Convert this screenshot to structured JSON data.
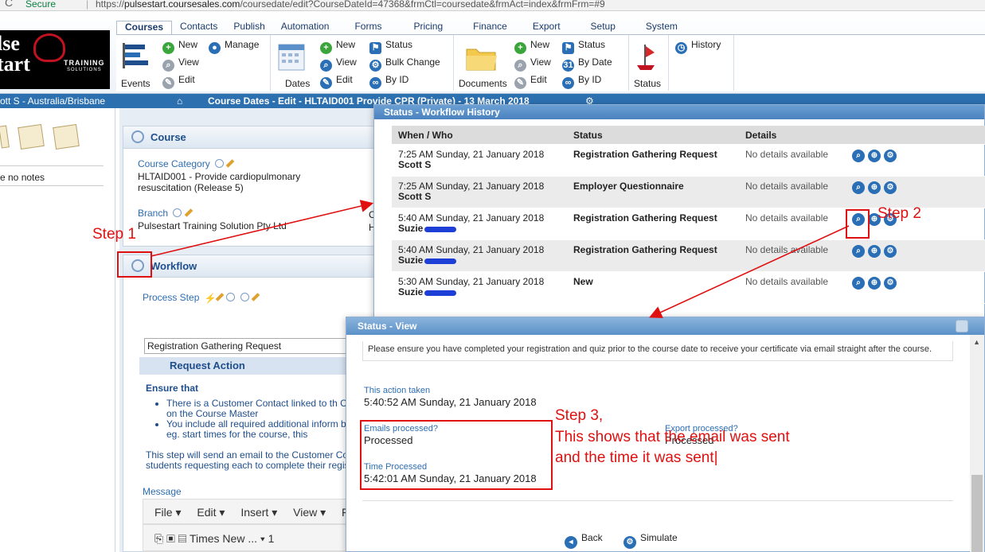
{
  "browser": {
    "secure_label": "Secure",
    "url_prefix": "https://",
    "url_host": "pulsestart.coursesales.com",
    "url_path": "/coursedate/edit?CourseDateId=47368&frmCtl=coursedate&frmAct=index&frmFrm=#9"
  },
  "logo": {
    "line1": "lse",
    "line2": "tart",
    "line3": "TRAINING",
    "line4": "SOLUTIONS"
  },
  "menu": {
    "tabs": [
      "Courses",
      "Contacts",
      "Publish",
      "Automation",
      "Forms",
      "Pricing",
      "Finance",
      "Export",
      "Setup",
      "System"
    ],
    "active": "Courses"
  },
  "ribbon": {
    "events_label": "Events",
    "events_new": "New",
    "events_manage": "Manage",
    "events_view": "View",
    "events_edit": "Edit",
    "dates_label": "Dates",
    "dates_new": "New",
    "dates_status": "Status",
    "dates_view": "View",
    "dates_bulk": "Bulk Change",
    "dates_edit": "Edit",
    "dates_byid": "By ID",
    "documents_label": "Documents",
    "docs_new": "New",
    "docs_status": "Status",
    "docs_view": "View",
    "docs_bydate": "By Date",
    "docs_edit": "Edit",
    "docs_byid": "By ID",
    "status_label": "Status",
    "history_label": "History"
  },
  "statusbar": {
    "location": "ott S - Australia/Brisbane",
    "title": "Course Dates - Edit - HLTAID001 Provide CPR (Private) - 13 March 2018"
  },
  "sidebar": {
    "notes_text": "e no notes"
  },
  "course_panel": {
    "heading": "Course",
    "category_label": "Course Category",
    "category_value": "HLTAID001 - Provide cardiopulmonary resuscitation (Release 5)",
    "branch_label": "Branch",
    "branch_value": "Pulsestart Training Solution Pty Ltd",
    "col_label_c": "C",
    "col_value_h": "H"
  },
  "workflow_panel": {
    "heading": "Workflow",
    "process_step_label": "Process Step",
    "process_step_value": "Registration Gathering Request",
    "request_action": "Request Action",
    "ensure_that": "Ensure that",
    "bullet1": "There is a Customer Contact linked to th Contact on the Course Master",
    "bullet2": "You include all required additional inform below, eg. start times for the course, this",
    "step_text": "This step will send an email to the Customer Co students requesting each to complete their regis",
    "message_label": "Message",
    "editor_menu": [
      "File ▾",
      "Edit ▾",
      "Insert ▾",
      "View ▾",
      "F"
    ],
    "font_name": "Times New ...",
    "font_size": "1"
  },
  "history_dialog": {
    "title": "Status - Workflow History",
    "headers": [
      "When / Who",
      "Status",
      "Details"
    ],
    "rows": [
      {
        "when": "7:25 AM Sunday, 21 January 2018",
        "who": "Scott S",
        "status": "Registration Gathering Request",
        "details": "No details available"
      },
      {
        "when": "7:25 AM Sunday, 21 January 2018",
        "who": "Scott S",
        "status": "Employer Questionnaire",
        "details": "No details available"
      },
      {
        "when": "5:40 AM Sunday, 21 January 2018",
        "who": "Suzie",
        "status": "Registration Gathering Request",
        "details": "No details available"
      },
      {
        "when": "5:40 AM Sunday, 21 January 2018",
        "who": "Suzie",
        "status": "Registration Gathering Request",
        "details": "No details available"
      },
      {
        "when": "5:30 AM Sunday, 21 January 2018",
        "who": "Suzie",
        "status": "New",
        "details": "No details available"
      }
    ]
  },
  "status_view": {
    "title": "Status - View",
    "message": "Please ensure you have completed your registration and quiz prior to the course date to receive your certificate via email straight after the course.",
    "action_taken_label": "This action taken",
    "action_taken_value": "5:40:52 AM Sunday, 21 January 2018",
    "emails_label": "Emails processed?",
    "emails_value": "Processed",
    "time_label": "Time Processed",
    "time_value": "5:42:01 AM Sunday, 21 January 2018",
    "export_label": "Export processed?",
    "export_value": "Processed",
    "back_label": "Back",
    "simulate_label": "Simulate"
  },
  "annotations": {
    "step1": "Step 1",
    "step2": "Step 2",
    "step3_line1": "Step 3,",
    "step3_line2": "This shows that the email was sent",
    "step3_line3": "and the time it was sent|"
  },
  "colors": {
    "annotation": "#e01010",
    "header_blue": "#2d70b0",
    "link_blue": "#2d6db0"
  }
}
